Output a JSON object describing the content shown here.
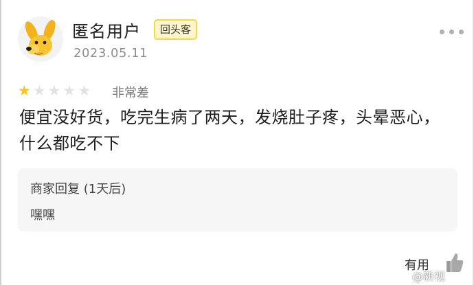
{
  "user": {
    "name": "匿名用户",
    "badge": "回头客",
    "date": "2023.05.11",
    "avatar_icon": "dog-avatar-icon"
  },
  "more_icon": "ellipsis-icon",
  "rating": {
    "stars_filled": 1,
    "stars_total": 5,
    "label": "非常差",
    "star_color": "#f5c518"
  },
  "review": {
    "line1": "便宜没好货，吃完生病了两天，发烧肚子疼，头晕恶心，",
    "line2": "什么都吃不下"
  },
  "merchant_reply": {
    "title": "商家回复 (1天后)",
    "body": "嘿嘿"
  },
  "footer": {
    "useful_label": "有用",
    "useful_icon": "thumbs-up-icon",
    "watermark": "@新视"
  },
  "colors": {
    "badge_border": "#f6d54a",
    "badge_bg": "#fff6c9",
    "reply_bg": "#f6f6f6"
  }
}
